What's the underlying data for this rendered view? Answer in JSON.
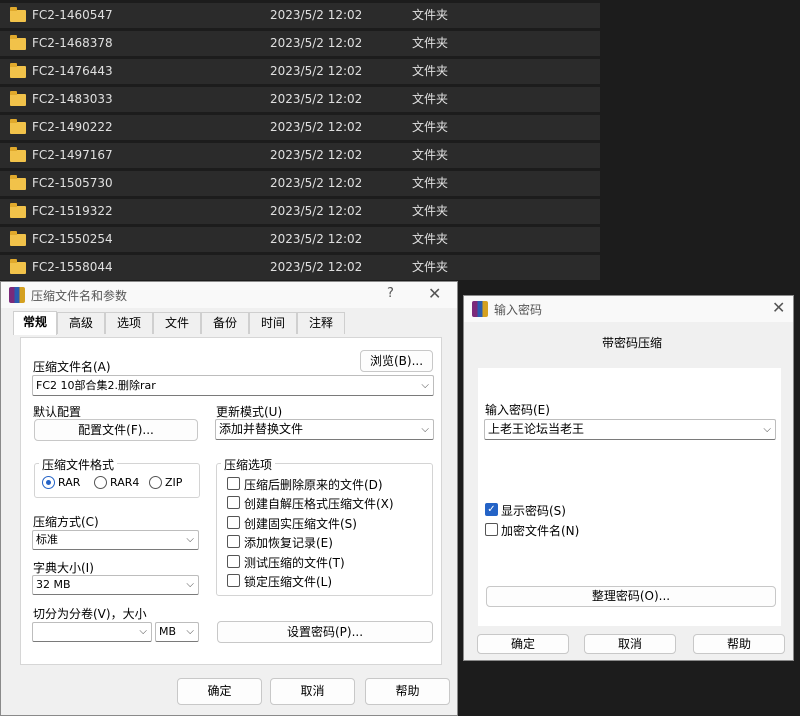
{
  "files": [
    {
      "name": "FC2-1460547",
      "date": "2023/5/2 12:02",
      "type": "文件夹"
    },
    {
      "name": "FC2-1468378",
      "date": "2023/5/2 12:02",
      "type": "文件夹"
    },
    {
      "name": "FC2-1476443",
      "date": "2023/5/2 12:02",
      "type": "文件夹"
    },
    {
      "name": "FC2-1483033",
      "date": "2023/5/2 12:02",
      "type": "文件夹"
    },
    {
      "name": "FC2-1490222",
      "date": "2023/5/2 12:02",
      "type": "文件夹"
    },
    {
      "name": "FC2-1497167",
      "date": "2023/5/2 12:02",
      "type": "文件夹"
    },
    {
      "name": "FC2-1505730",
      "date": "2023/5/2 12:02",
      "type": "文件夹"
    },
    {
      "name": "FC2-1519322",
      "date": "2023/5/2 12:02",
      "type": "文件夹"
    },
    {
      "name": "FC2-1550254",
      "date": "2023/5/2 12:02",
      "type": "文件夹"
    },
    {
      "name": "FC2-1558044",
      "date": "2023/5/2 12:02",
      "type": "文件夹"
    }
  ],
  "archive_dialog": {
    "title": "压缩文件名和参数",
    "help": "?",
    "close": "✕",
    "tabs": [
      "常规",
      "高级",
      "选项",
      "文件",
      "备份",
      "时间",
      "注释"
    ],
    "archive_name_label": "压缩文件名(A)",
    "browse_button": "浏览(B)...",
    "archive_name_value": "FC2 10部合集2.删除rar",
    "default_profile_label": "默认配置",
    "profiles_button": "配置文件(F)...",
    "update_mode_label": "更新模式(U)",
    "update_mode_value": "添加并替换文件",
    "format_group": "压缩文件格式",
    "formats": [
      "RAR",
      "RAR4",
      "ZIP"
    ],
    "options_group": "压缩选项",
    "options": [
      {
        "label": "压缩后删除原来的文件(D)",
        "checked": false
      },
      {
        "label": "创建自解压格式压缩文件(X)",
        "checked": false
      },
      {
        "label": "创建固实压缩文件(S)",
        "checked": false
      },
      {
        "label": "添加恢复记录(E)",
        "checked": false
      },
      {
        "label": "测试压缩的文件(T)",
        "checked": false
      },
      {
        "label": "锁定压缩文件(L)",
        "checked": false
      }
    ],
    "method_label": "压缩方式(C)",
    "method_value": "标准",
    "dict_label": "字典大小(I)",
    "dict_value": "32 MB",
    "split_label": "切分为分卷(V)，大小",
    "split_value": "",
    "split_unit": "MB",
    "set_password_button": "设置密码(P)...",
    "ok": "确定",
    "cancel": "取消",
    "help_button": "帮助"
  },
  "password_dialog": {
    "title": "输入密码",
    "close": "✕",
    "heading": "带密码压缩",
    "password_label": "输入密码(E)",
    "password_value": "上老王论坛当老王",
    "show_password": "显示密码(S)",
    "show_password_checked": true,
    "encrypt_names": "加密文件名(N)",
    "encrypt_names_checked": false,
    "organize_button": "整理密码(O)...",
    "ok": "确定",
    "cancel": "取消",
    "help": "帮助"
  },
  "colors": {
    "accent": "#2463c6",
    "folder": "#f1c24a",
    "explorer_bg": "#2b2b2b"
  }
}
